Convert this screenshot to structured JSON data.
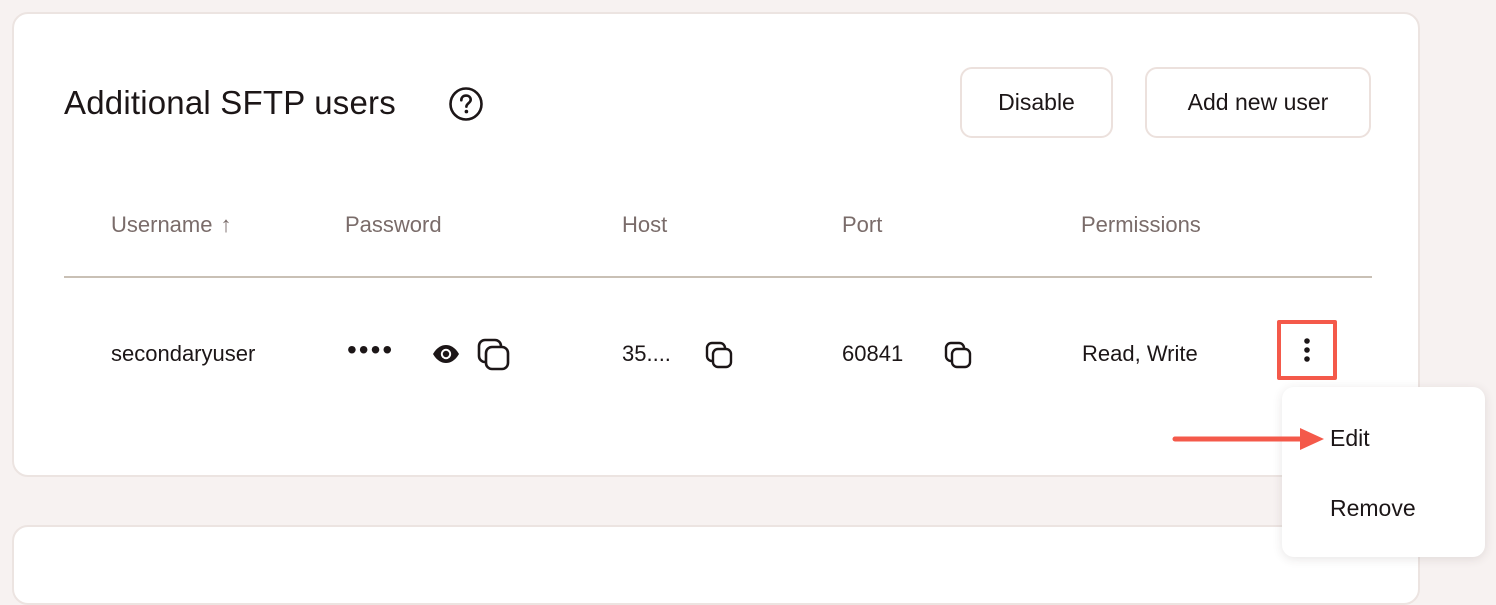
{
  "section": {
    "title": "Additional SFTP users",
    "help_icon": "question-circle-icon",
    "buttons": {
      "disable": "Disable",
      "add_user": "Add new user"
    }
  },
  "table": {
    "columns": [
      "Username",
      "Password",
      "Host",
      "Port",
      "Permissions"
    ],
    "sort_indicator": "↑",
    "rows": [
      {
        "username": "secondaryuser",
        "password": "••••",
        "host": "35....",
        "port": "60841",
        "permissions": "Read, Write"
      }
    ]
  },
  "icons": {
    "reveal": "eye-icon",
    "copy": "copy-icon",
    "row_menu": "kebab-menu-icon"
  },
  "menu": {
    "items": [
      "Edit",
      "Remove"
    ]
  },
  "colors": {
    "background": "#f7f2f1",
    "card": "#ffffff",
    "border": "#ece4e1",
    "text": "#1c1617",
    "muted_text": "#7a6c6a",
    "highlight": "#f4594a"
  }
}
